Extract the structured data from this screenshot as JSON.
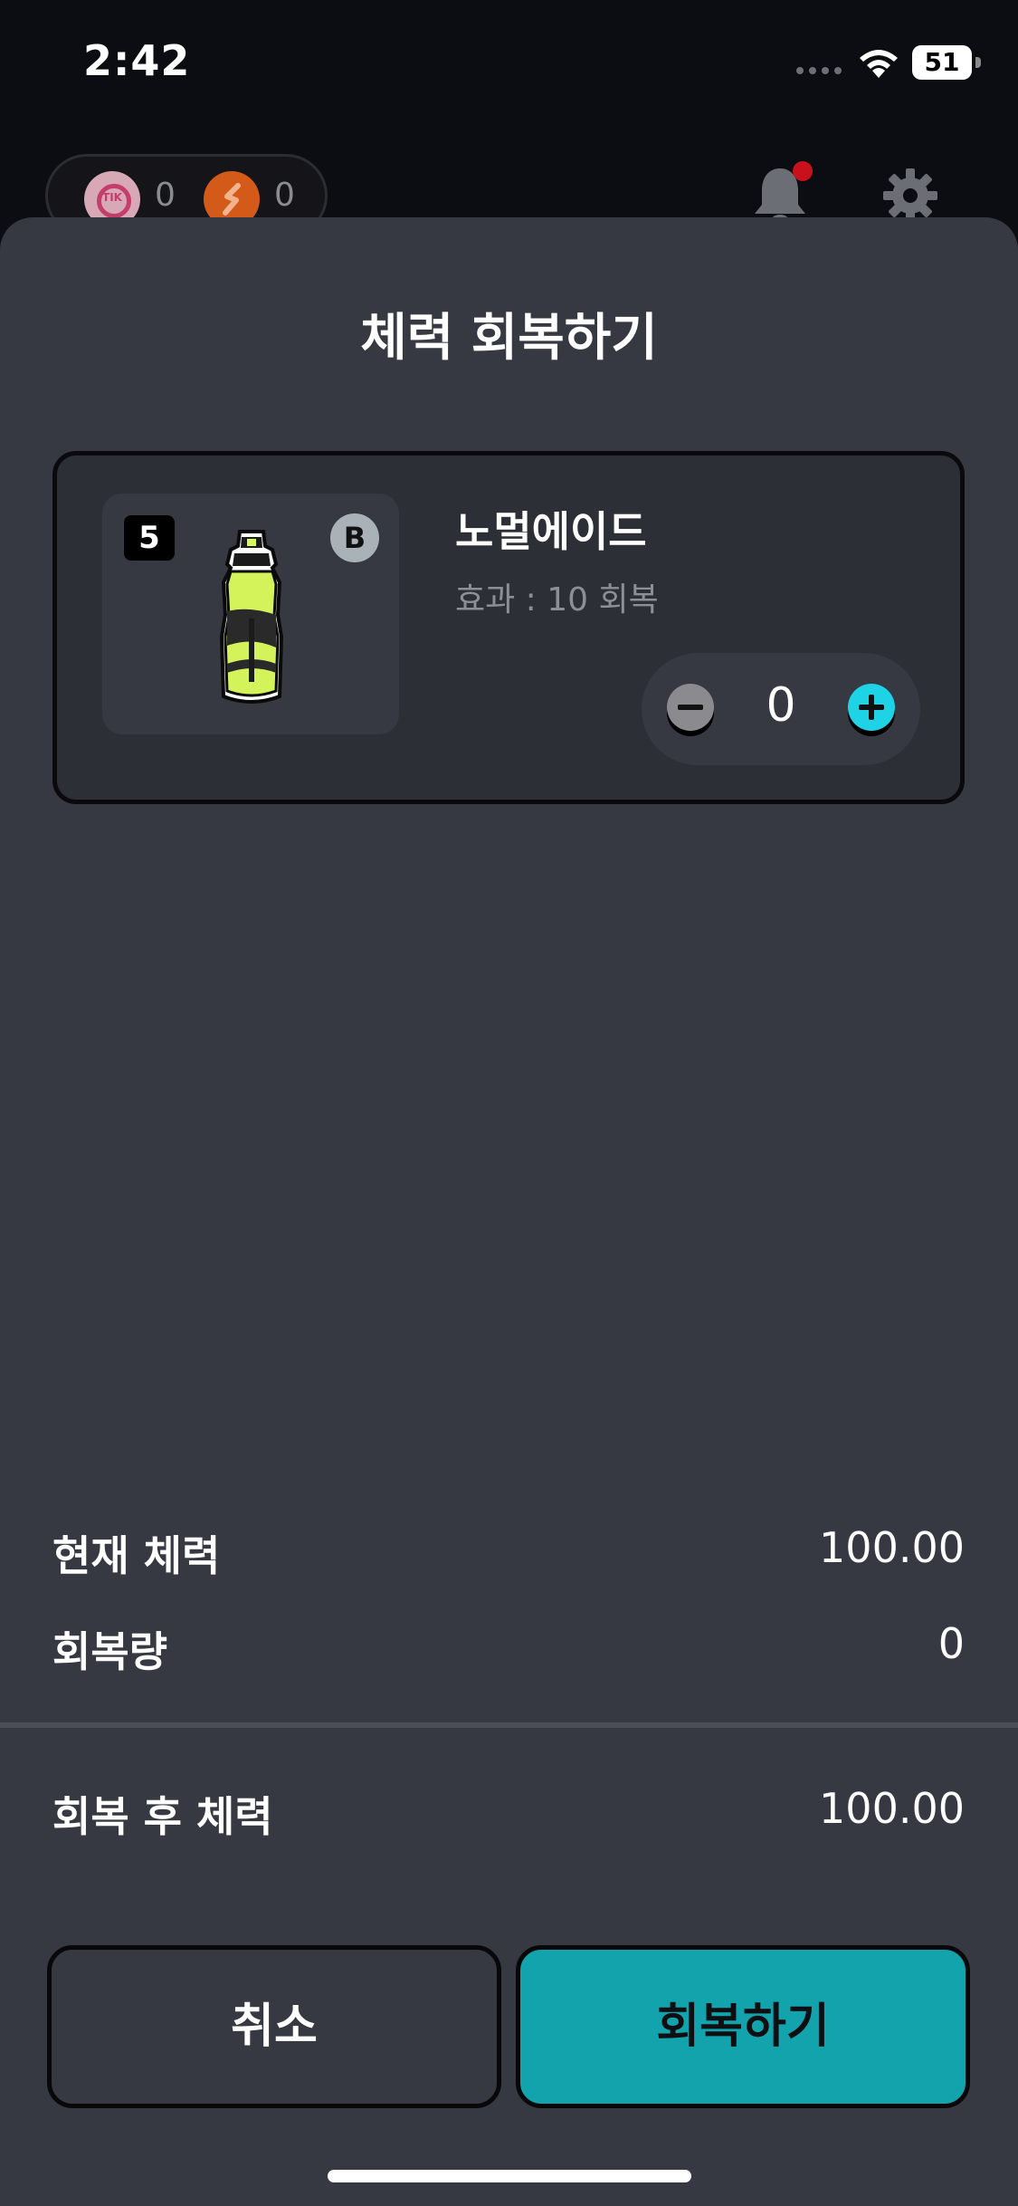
{
  "status_bar": {
    "time": "2:42",
    "battery_level": "51"
  },
  "header": {
    "currencies": [
      {
        "icon": "tik-coin-icon",
        "label": "TIK",
        "count": "0"
      },
      {
        "icon": "s-coin-icon",
        "count": "0"
      }
    ],
    "notification_badge": true
  },
  "sheet": {
    "title": "체력 회복하기",
    "item": {
      "quantity_badge": "5",
      "grade_badge": "B",
      "name": "노멀에이드",
      "effect": "효과 : 10 회복",
      "stepper_value": "0"
    },
    "summary": {
      "current_label": "현재 체력",
      "current_value": "100.00",
      "recovery_label": "회복량",
      "recovery_value": "0",
      "after_label": "회복 후 체력",
      "after_value": "100.00"
    },
    "buttons": {
      "cancel": "취소",
      "confirm": "회복하기"
    }
  },
  "colors": {
    "accent": "#12a3ad",
    "sheet_bg": "#363842",
    "card_bg": "#2d2f37",
    "plus_button": "#1fd3e6",
    "notification_dot": "#c8111a"
  }
}
